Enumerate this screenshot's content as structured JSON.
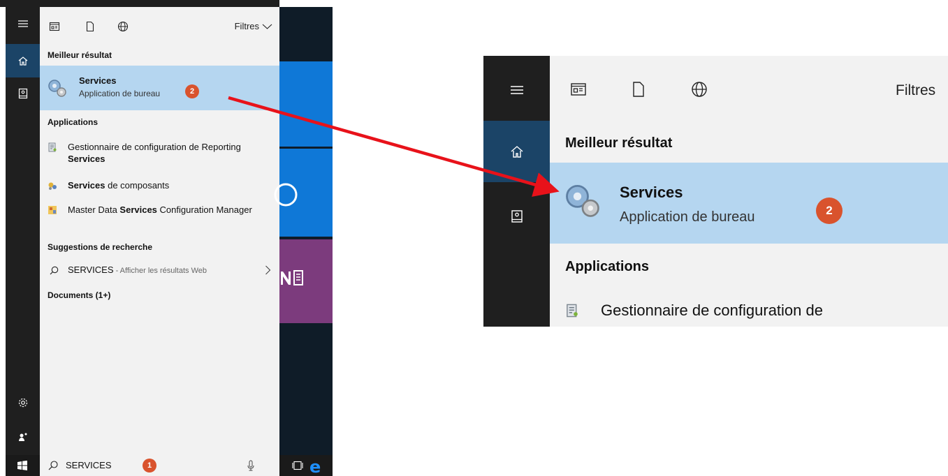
{
  "panel": {
    "filters_label": "Filtres",
    "best_heading": "Meilleur résultat",
    "best_result": {
      "name": "Services",
      "subtitle": "Application de bureau",
      "badge": "2"
    },
    "apps_heading": "Applications",
    "apps": [
      {
        "pre": "Gestionnaire de configuration de Reporting ",
        "bold": "Services",
        "post": ""
      },
      {
        "pre": "",
        "bold": "Services",
        "post": " de composants"
      },
      {
        "pre": "Master Data ",
        "bold": "Services",
        "post": " Configuration Manager"
      }
    ],
    "suggestions_heading": "Suggestions de recherche",
    "web_suggestion": {
      "query": "SERVICES",
      "suffix": " - Afficher les résultats Web"
    },
    "documents_heading": "Documents (1+)"
  },
  "taskbar": {
    "search_value": "SERVICES",
    "badge": "1"
  },
  "zoom": {
    "filters_label": "Filtres",
    "best_heading": "Meilleur résultat",
    "best_result": {
      "name": "Services",
      "subtitle": "Application de bureau",
      "badge": "2"
    },
    "apps_heading": "Applications",
    "first_app": "Gestionnaire de configuration de"
  },
  "colors": {
    "rail": "#1f1f1f",
    "rail_active": "#1b4467",
    "highlight": "#b5d6f0",
    "badge": "#d9532d",
    "arrow": "#e8121a",
    "tile_blue": "#0f78d7",
    "tile_purple": "#7c3b7d"
  }
}
